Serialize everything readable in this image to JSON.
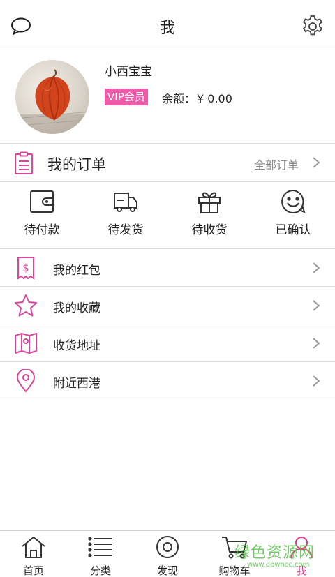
{
  "header": {
    "title": "我",
    "message_icon": "chat-bubble-icon",
    "settings_icon": "gear-icon"
  },
  "profile": {
    "username": "小西宝宝",
    "vip_label": "VIP会员",
    "balance_label": "余额：",
    "balance_value": "¥ 0.00",
    "avatar_icon": "physalis-avatar"
  },
  "orders": {
    "title": "我的订单",
    "all_label": "全部订单",
    "statuses": [
      {
        "label": "待付款",
        "icon": "wallet-icon"
      },
      {
        "label": "待发货",
        "icon": "truck-icon"
      },
      {
        "label": "待收货",
        "icon": "gift-icon"
      },
      {
        "label": "已确认",
        "icon": "smile-icon"
      }
    ]
  },
  "menu": [
    {
      "label": "我的红包",
      "icon": "red-envelope-icon"
    },
    {
      "label": "我的收藏",
      "icon": "star-icon"
    },
    {
      "label": "收货地址",
      "icon": "map-icon"
    },
    {
      "label": "附近西港",
      "icon": "location-pin-icon"
    }
  ],
  "nav": [
    {
      "label": "首页",
      "icon": "home-icon",
      "active": false
    },
    {
      "label": "分类",
      "icon": "list-icon",
      "active": false
    },
    {
      "label": "发现",
      "icon": "discover-icon",
      "active": false
    },
    {
      "label": "购物车",
      "icon": "cart-icon",
      "active": false
    },
    {
      "label": "我",
      "icon": "user-icon",
      "active": true
    }
  ],
  "watermark": {
    "text": "绿色资源网",
    "url": "www.downcc.com"
  },
  "colors": {
    "accent": "#ef5aa9",
    "icon_pink": "#d7479a",
    "active_nav": "#e0388a",
    "divider": "#dcdcdc"
  }
}
